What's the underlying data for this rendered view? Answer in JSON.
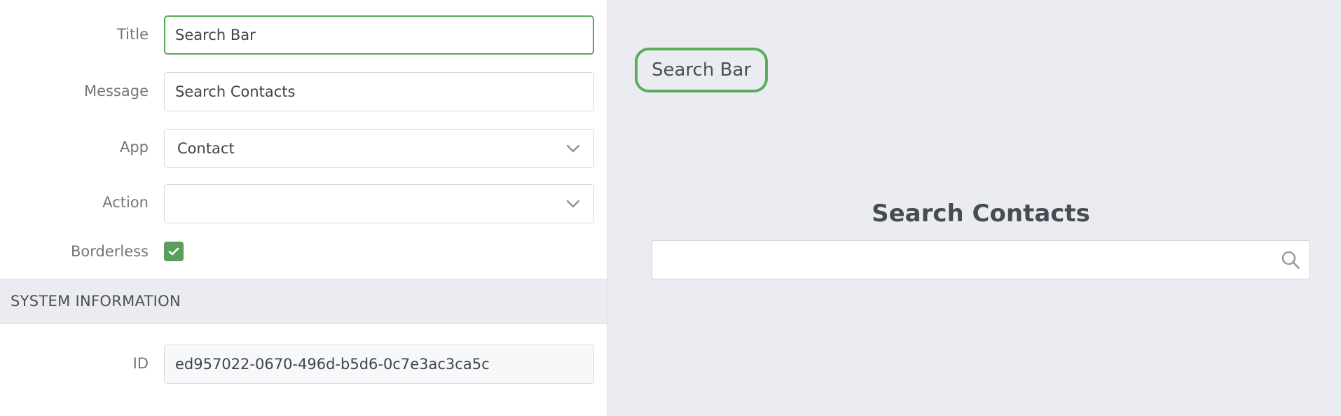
{
  "form": {
    "title_label": "Title",
    "title_value": "Search Bar",
    "message_label": "Message",
    "message_value": "Search Contacts",
    "app_label": "App",
    "app_value": "Contact",
    "action_label": "Action",
    "action_value": "",
    "borderless_label": "Borderless",
    "borderless_checked": true
  },
  "system_info": {
    "section_title": "SYSTEM INFORMATION",
    "id_label": "ID",
    "id_value": "ed957022-0670-496d-b5d6-0c7e3ac3ca5c"
  },
  "preview": {
    "badge_label": "Search Bar",
    "message_title": "Search Contacts",
    "search_placeholder": ""
  },
  "icons": {
    "chevron": "chevron-down-icon",
    "check": "checkmark-icon",
    "search": "search-icon"
  },
  "colors": {
    "accent_green": "#5aad5e",
    "checkbox_green": "#5a9e5c",
    "panel_background": "#ebecf1"
  }
}
